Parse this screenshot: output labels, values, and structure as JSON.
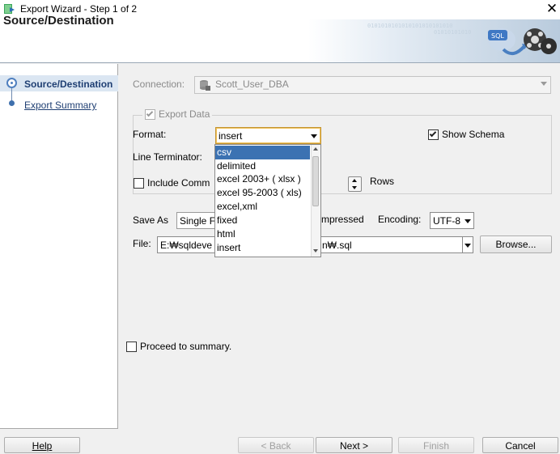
{
  "window": {
    "title": "Export Wizard - Step 1 of 2"
  },
  "header": {
    "title": "Source/Destination",
    "binary_text_1": "0101010101010101010101010",
    "binary_text_2": "01010101010",
    "icon": "export-database-icon"
  },
  "nav": {
    "items": [
      {
        "label": "Source/Destination",
        "selected": true
      },
      {
        "label": "Export Summary",
        "selected": false
      }
    ]
  },
  "form": {
    "connection_label": "Connection:",
    "connection_value": "Scott_User_DBA",
    "export_data_label": "Export Data",
    "format_label": "Format:",
    "format_value": "insert",
    "show_schema_label": "Show Schema",
    "line_terminator_label": "Line Terminator:",
    "include_label": "Include Comm",
    "rows_label": "Rows",
    "save_as_label": "Save As",
    "save_as_value": "Single F",
    "compressed_label": "mpressed",
    "encoding_label": "Encoding:",
    "encoding_value": "UTF-8",
    "file_label": "File:",
    "file_prefix": "E:₩sqldeve",
    "file_suffix": "n₩.sql",
    "browse_label": "Browse...",
    "proceed_label": "Proceed to summary."
  },
  "format_dropdown": {
    "options": [
      "csv",
      "delimited",
      "excel 2003+ ( xlsx )",
      "excel 95-2003 ( xls)",
      "excel,xml",
      "fixed",
      "html",
      "insert"
    ],
    "highlighted": "csv"
  },
  "buttons": {
    "help": "Help",
    "back": "< Back",
    "next": "Next >",
    "finish": "Finish",
    "cancel": "Cancel"
  }
}
